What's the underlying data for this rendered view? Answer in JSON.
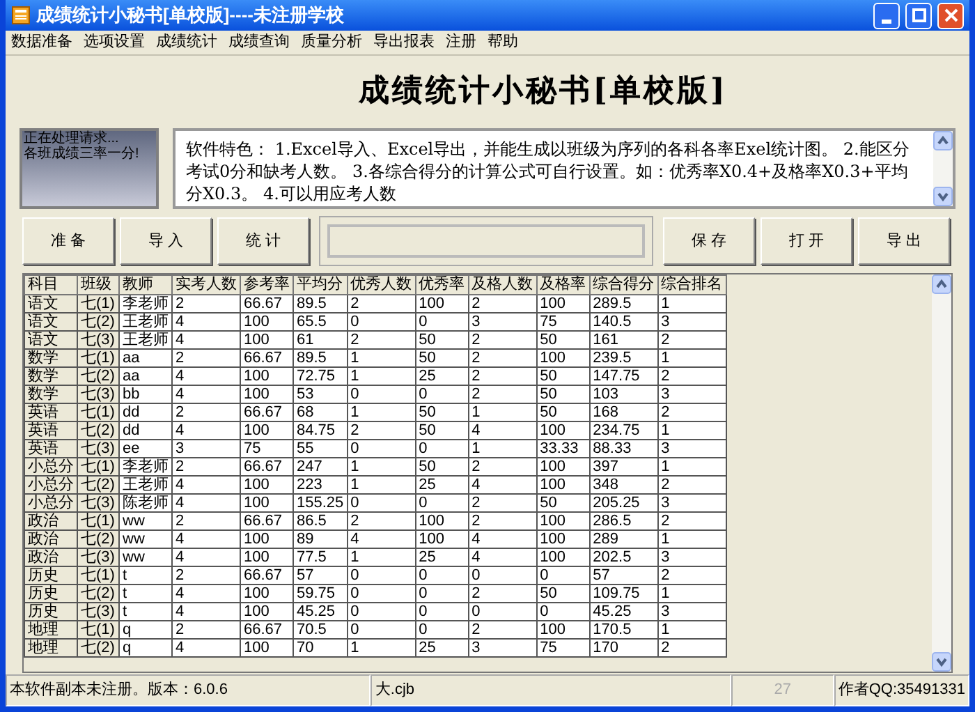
{
  "window": {
    "title": "成绩统计小秘书[单校版]----未注册学校"
  },
  "menu": [
    "数据准备",
    "选项设置",
    "成绩统计",
    "成绩查询",
    "质量分析",
    "导出报表",
    "注册",
    "帮助"
  ],
  "banner": {
    "title": "成绩统计小秘书[单校版]"
  },
  "progress": {
    "level": 0
  },
  "log": [
    "正在处理请求...",
    "各班成绩三率一分!"
  ],
  "description": "软件特色： 1.Excel导入、Excel导出，并能生成以班级为序列的各科各率Exel统计图。 2.能区分考试0分和缺考人数。 3.各综合得分的计算公式可自行设置。如：优秀率X0.4+及格率X0.3+平均分X0.3。 4.可以用应考人数",
  "buttons_left": [
    "准 备",
    "导 入",
    "统 计"
  ],
  "buttons_right": [
    "保 存",
    "打 开",
    "导 出"
  ],
  "table": {
    "columns": [
      "科目",
      "班级",
      "教师",
      "实考人数",
      "参考率",
      "平均分",
      "优秀人数",
      "优秀率",
      "及格人数",
      "及格率",
      "综合得分",
      "综合排名"
    ],
    "rows": [
      [
        "语文",
        "七(1)",
        "李老师",
        "2",
        "66.67",
        "89.5",
        "2",
        "100",
        "2",
        "100",
        "289.5",
        "1"
      ],
      [
        "语文",
        "七(2)",
        "王老师",
        "4",
        "100",
        "65.5",
        "0",
        "0",
        "3",
        "75",
        "140.5",
        "3"
      ],
      [
        "语文",
        "七(3)",
        "王老师",
        "4",
        "100",
        "61",
        "2",
        "50",
        "2",
        "50",
        "161",
        "2"
      ],
      [
        "数学",
        "七(1)",
        "aa",
        "2",
        "66.67",
        "89.5",
        "1",
        "50",
        "2",
        "100",
        "239.5",
        "1"
      ],
      [
        "数学",
        "七(2)",
        "aa",
        "4",
        "100",
        "72.75",
        "1",
        "25",
        "2",
        "50",
        "147.75",
        "2"
      ],
      [
        "数学",
        "七(3)",
        "bb",
        "4",
        "100",
        "53",
        "0",
        "0",
        "2",
        "50",
        "103",
        "3"
      ],
      [
        "英语",
        "七(1)",
        "dd",
        "2",
        "66.67",
        "68",
        "1",
        "50",
        "1",
        "50",
        "168",
        "2"
      ],
      [
        "英语",
        "七(2)",
        "dd",
        "4",
        "100",
        "84.75",
        "2",
        "50",
        "4",
        "100",
        "234.75",
        "1"
      ],
      [
        "英语",
        "七(3)",
        "ee",
        "3",
        "75",
        "55",
        "0",
        "0",
        "1",
        "33.33",
        "88.33",
        "3"
      ],
      [
        "小总分",
        "七(1)",
        "李老师",
        "2",
        "66.67",
        "247",
        "1",
        "50",
        "2",
        "100",
        "397",
        "1"
      ],
      [
        "小总分",
        "七(2)",
        "王老师",
        "4",
        "100",
        "223",
        "1",
        "25",
        "4",
        "100",
        "348",
        "2"
      ],
      [
        "小总分",
        "七(3)",
        "陈老师",
        "4",
        "100",
        "155.25",
        "0",
        "0",
        "2",
        "50",
        "205.25",
        "3"
      ],
      [
        "政治",
        "七(1)",
        "ww",
        "2",
        "66.67",
        "86.5",
        "2",
        "100",
        "2",
        "100",
        "286.5",
        "2"
      ],
      [
        "政治",
        "七(2)",
        "ww",
        "4",
        "100",
        "89",
        "4",
        "100",
        "4",
        "100",
        "289",
        "1"
      ],
      [
        "政治",
        "七(3)",
        "ww",
        "4",
        "100",
        "77.5",
        "1",
        "25",
        "4",
        "100",
        "202.5",
        "3"
      ],
      [
        "历史",
        "七(1)",
        "t",
        "2",
        "66.67",
        "57",
        "0",
        "0",
        "0",
        "0",
        "57",
        "2"
      ],
      [
        "历史",
        "七(2)",
        "t",
        "4",
        "100",
        "59.75",
        "0",
        "0",
        "2",
        "50",
        "109.75",
        "1"
      ],
      [
        "历史",
        "七(3)",
        "t",
        "4",
        "100",
        "45.25",
        "0",
        "0",
        "0",
        "0",
        "45.25",
        "3"
      ],
      [
        "地理",
        "七(1)",
        "q",
        "2",
        "66.67",
        "70.5",
        "0",
        "0",
        "2",
        "100",
        "170.5",
        "1"
      ],
      [
        "地理",
        "七(2)",
        "q",
        "4",
        "100",
        "70",
        "1",
        "25",
        "3",
        "75",
        "170",
        "2"
      ]
    ]
  },
  "status_bar": [
    "本软件副本未注册。版本：6.0.6",
    "大.cjb",
    "27",
    "作者QQ:35491331"
  ],
  "status_disabled": [
    false,
    false,
    true,
    false
  ]
}
